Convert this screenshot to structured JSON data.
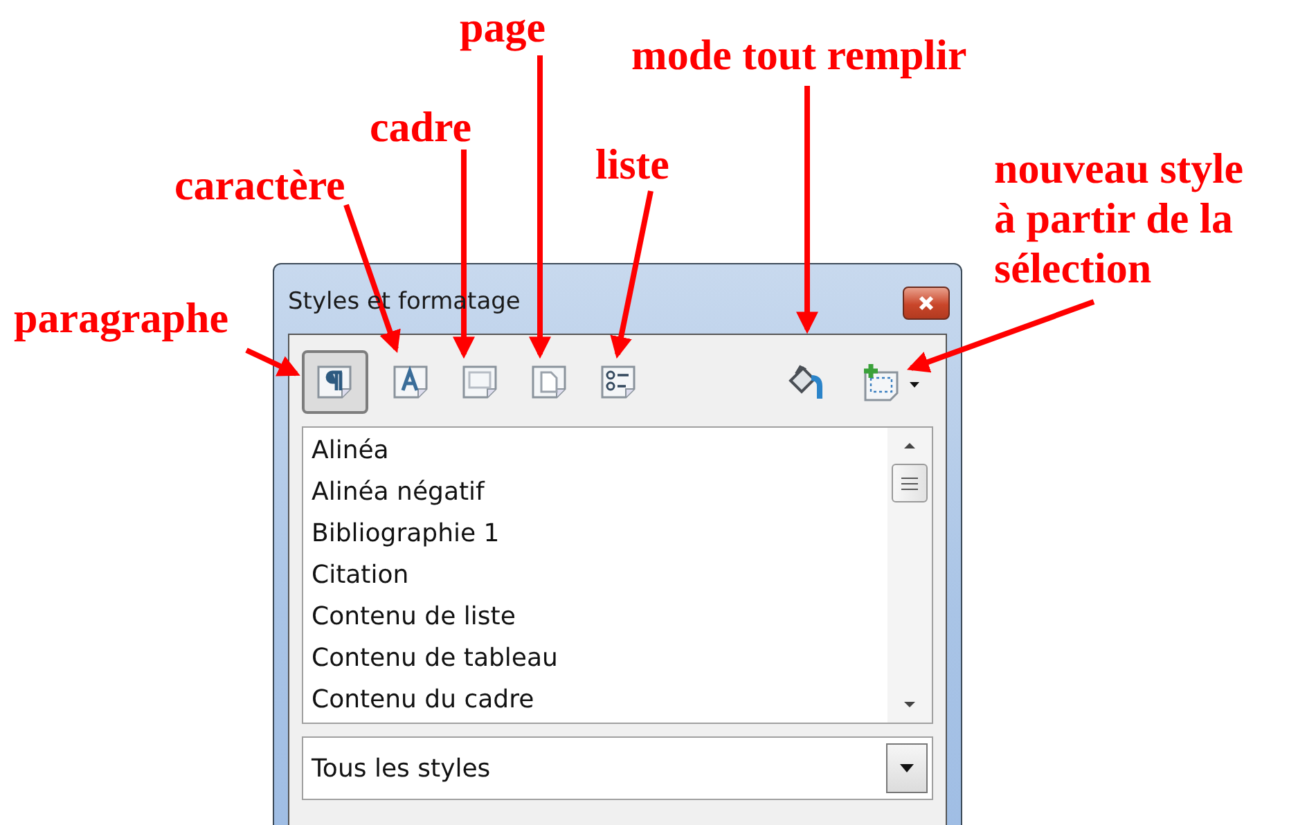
{
  "window": {
    "title": "Styles et formatage"
  },
  "style_families": [
    {
      "kind": "paragraph",
      "selected": true
    },
    {
      "kind": "character",
      "selected": false
    },
    {
      "kind": "frame",
      "selected": false
    },
    {
      "kind": "page",
      "selected": false
    },
    {
      "kind": "list",
      "selected": false
    }
  ],
  "actions": [
    {
      "kind": "fill"
    },
    {
      "kind": "new-style"
    }
  ],
  "styles": [
    "Alinéa",
    "Alinéa négatif",
    "Bibliographie 1",
    "Citation",
    "Contenu de liste",
    "Contenu de tableau",
    "Contenu du cadre"
  ],
  "filter": {
    "value": "Tous les styles"
  },
  "annotations": [
    {
      "text": "paragraphe"
    },
    {
      "text": "caractère"
    },
    {
      "text": "cadre"
    },
    {
      "text": "page"
    },
    {
      "text": "liste"
    },
    {
      "text": "mode tout remplir"
    },
    {
      "text": "nouveau style à partir de la sélection"
    }
  ]
}
